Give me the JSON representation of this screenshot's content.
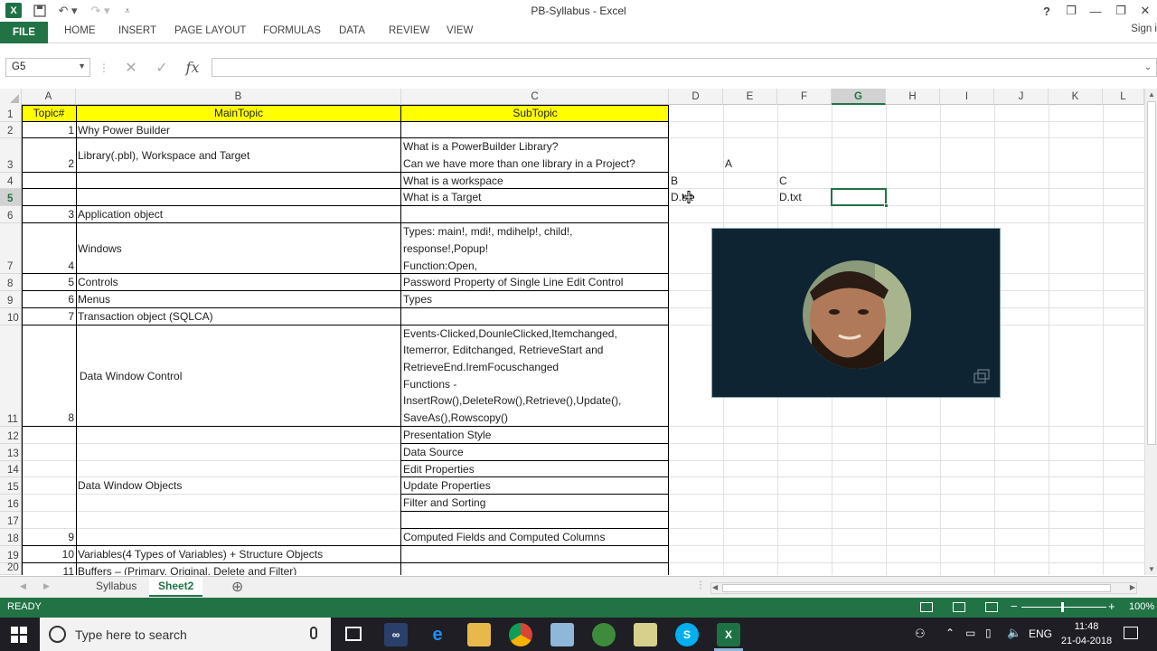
{
  "window": {
    "title": "PB-Syllabus - Excel",
    "help": "?",
    "restore_ribbon": "❐",
    "minimize": "—",
    "maximize": "❐",
    "close": "✕"
  },
  "ribbon": {
    "tabs": [
      "FILE",
      "HOME",
      "INSERT",
      "PAGE LAYOUT",
      "FORMULAS",
      "DATA",
      "REVIEW",
      "VIEW"
    ],
    "signin": "Sign i"
  },
  "formula_bar": {
    "name_box": "G5",
    "formula": ""
  },
  "columns": [
    "A",
    "B",
    "C",
    "D",
    "E",
    "F",
    "G",
    "H",
    "I",
    "J",
    "K",
    "L"
  ],
  "selected_column": "G",
  "selected_row": "5",
  "rows": [
    "1",
    "2",
    "3",
    "4",
    "5",
    "6",
    "7",
    "8",
    "9",
    "10",
    "11",
    "12",
    "13",
    "14",
    "15",
    "16",
    "17",
    "18",
    "19",
    "20"
  ],
  "header": {
    "a": "Topic#",
    "b": "MainTopic",
    "c": "SubTopic"
  },
  "cells": {
    "a2": "1",
    "b2": "Why Power Builder",
    "b3": "Library(.pbl), Workspace and Target",
    "a3": "2",
    "c3_1": "What is a PowerBuilder Library?",
    "c3_2": "Can we have more than one library in a Project?",
    "e3": "A",
    "c4": "What is a workspace",
    "d4": "B",
    "f4": "C",
    "c5": "What is a Target",
    "d5": "D.txt",
    "f5": "D.txt",
    "a6": "3",
    "b6": "Application object",
    "b7": "Windows",
    "a7": "4",
    "c7_1": "Types: main!, mdi!,  mdihelp!, child!,",
    "c7_2": "response!,Popup!",
    "c7_3": "Function:Open,",
    "a8": "5",
    "b8": "Controls",
    "c8": "Password Property of Single Line Edit Control",
    "a9": "6",
    "b9": "Menus",
    "c9": "Types",
    "a10": "7",
    "b10": "Transaction object (SQLCA)",
    "b11": "Data Window Control",
    "a11": "8",
    "c11_1": "Events-Clicked,DounleClicked,Itemchanged,",
    "c11_2": "Itemerror, Editchanged, RetrieveStart and",
    "c11_3": "RetrieveEnd.IremFocuschanged",
    "c11_4": "Functions -",
    "c11_5": "InsertRow(),DeleteRow(),Retrieve(),Update(),",
    "c11_6": "SaveAs(),Rowscopy()",
    "c12": "Presentation Style",
    "c13": "Data Source",
    "c14": "Edit Properties",
    "c15": "Update Properties",
    "c16": "Filter and Sorting",
    "b_dwo": "Data Window Objects",
    "a18": "9",
    "c18": "Computed Fields and Computed Columns",
    "a19": "10",
    "b19": "Variables(4 Types of Variables) + Structure Objects",
    "a20": "11",
    "b20": "Buffers – (Primary, Original, Delete and Filter)"
  },
  "sheets": {
    "tabs": [
      "Syllabus",
      "Sheet2"
    ],
    "active": "Sheet2",
    "add": "⊕"
  },
  "status": {
    "ready": "READY",
    "zoom": "100%"
  },
  "taskbar": {
    "search_placeholder": "Type here to search",
    "lang": "ENG",
    "time": "11:48",
    "date": "21-04-2018"
  },
  "colors": {
    "excel_green": "#217346",
    "header_yellow": "#ffff00",
    "taskbar": "#1e1e24"
  }
}
